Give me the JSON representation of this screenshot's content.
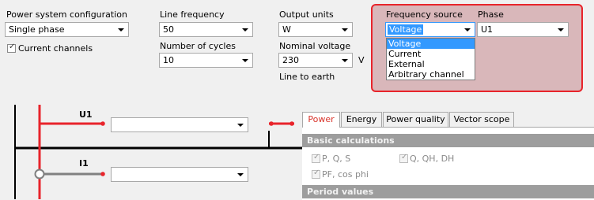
{
  "power_system": {
    "label": "Power system configuration",
    "value": "Single phase"
  },
  "current_channels": {
    "label": "Current channels",
    "checked": true
  },
  "line_frequency": {
    "label": "Line frequency",
    "value": "50"
  },
  "number_of_cycles": {
    "label": "Number of cycles",
    "value": "10"
  },
  "output_units": {
    "label": "Output units",
    "value": "W"
  },
  "nominal_voltage": {
    "label": "Nominal voltage",
    "value": "230",
    "unit": "V",
    "sublabel": "Line to earth"
  },
  "frequency_source": {
    "label": "Frequency source",
    "value": "Voltage",
    "options": [
      "Voltage",
      "Current",
      "External",
      "Arbitrary channel"
    ]
  },
  "phase": {
    "label": "Phase",
    "value": "U1"
  },
  "diagram": {
    "u1_label": "U1",
    "i1_label": "I1",
    "u1_value": "",
    "i1_value": ""
  },
  "tabs": [
    "Power",
    "Energy",
    "Power quality",
    "Vector scope"
  ],
  "active_tab": "Power",
  "basic_calculations": {
    "header": "Basic calculations",
    "items": [
      {
        "label": "P, Q, S",
        "checked": true
      },
      {
        "label": "Q, QH, DH",
        "checked": true
      },
      {
        "label": "PF, cos phi",
        "checked": true
      }
    ]
  },
  "period_values": {
    "header": "Period values"
  },
  "colors": {
    "accent_red": "#e8242b",
    "highlight": "#d9b7ba",
    "selection": "#3399ff"
  }
}
